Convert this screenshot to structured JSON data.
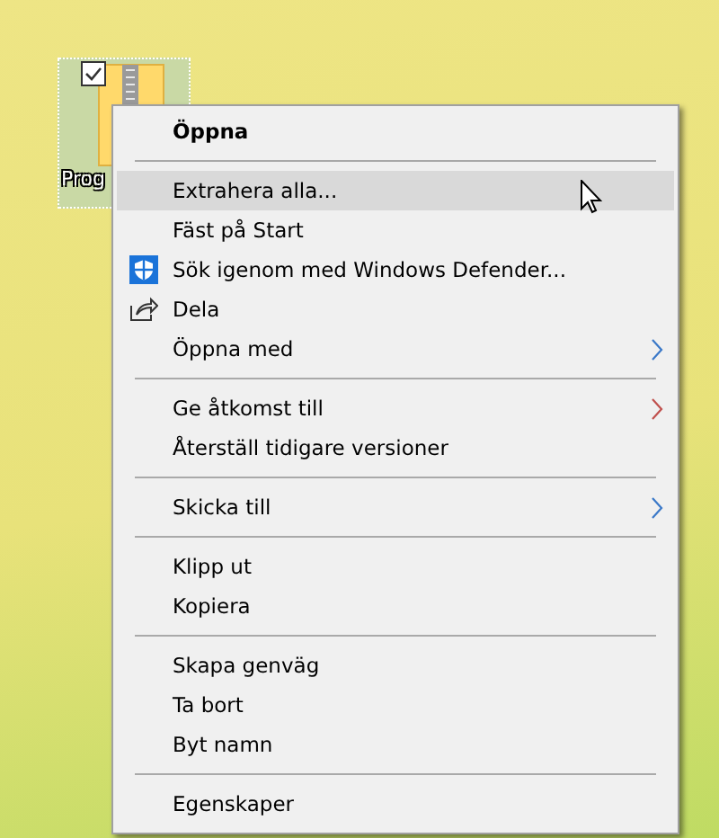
{
  "desktop_icon": {
    "label": "Prog",
    "checked": true,
    "selected": true
  },
  "menu": [
    {
      "kind": "item",
      "label": "Öppna",
      "bold": true,
      "selected": false
    },
    {
      "kind": "separator"
    },
    {
      "kind": "item",
      "label": "Extrahera alla...",
      "bold": false,
      "selected": true
    },
    {
      "kind": "item",
      "label": "Fäst på Start",
      "bold": false,
      "selected": false
    },
    {
      "kind": "shield",
      "label": "Sök igenom med Windows Defender...",
      "bold": false,
      "selected": false
    },
    {
      "kind": "share",
      "label": "Dela",
      "bold": false,
      "selected": false
    },
    {
      "kind": "item",
      "label": "Öppna med",
      "bold": false,
      "selected": false,
      "submenu": true,
      "color": "#3a78c8"
    },
    {
      "kind": "separator"
    },
    {
      "kind": "item",
      "label": "Ge åtkomst till",
      "bold": false,
      "selected": false,
      "submenu": true,
      "color": "#c0504d"
    },
    {
      "kind": "item",
      "label": "Återställ tidigare versioner",
      "bold": false,
      "selected": false
    },
    {
      "kind": "separator"
    },
    {
      "kind": "item",
      "label": "Skicka till",
      "bold": false,
      "selected": false,
      "submenu": true,
      "color": "#3a78c8"
    },
    {
      "kind": "separator"
    },
    {
      "kind": "item",
      "label": "Klipp ut",
      "bold": false,
      "selected": false
    },
    {
      "kind": "item",
      "label": "Kopiera",
      "bold": false,
      "selected": false
    },
    {
      "kind": "separator"
    },
    {
      "kind": "item",
      "label": "Skapa genväg",
      "bold": false,
      "selected": false
    },
    {
      "kind": "item",
      "label": "Ta bort",
      "bold": false,
      "selected": false
    },
    {
      "kind": "item",
      "label": "Byt namn",
      "bold": false,
      "selected": false
    },
    {
      "kind": "separator"
    },
    {
      "kind": "item",
      "label": "Egenskaper",
      "bold": false,
      "selected": false
    }
  ]
}
